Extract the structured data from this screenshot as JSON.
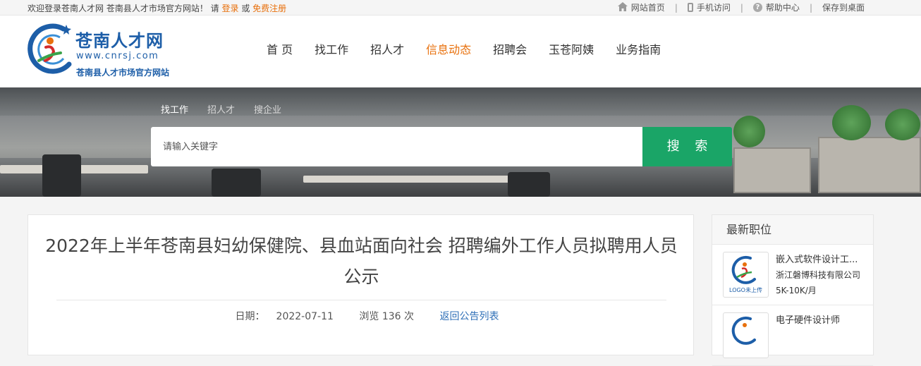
{
  "topbar": {
    "welcome_prefix": "欢迎登录苍南人才网 苍南县人才市场官方网站！ 请",
    "login": "登录",
    "or": "或",
    "register": "免费注册",
    "links": [
      {
        "icon": "home-icon",
        "label": "网站首页"
      },
      {
        "icon": "phone-icon",
        "label": "手机访问"
      },
      {
        "icon": "help-icon",
        "label": "帮助中心"
      },
      {
        "icon": "",
        "label": "保存到桌面"
      }
    ],
    "separator": "|"
  },
  "logo": {
    "name": "苍南人才网",
    "url": "www.cnrsj.com",
    "slogan": "苍南县人才市场官方网站"
  },
  "nav": {
    "items": [
      "首 页",
      "找工作",
      "招人才",
      "信息动态",
      "招聘会",
      "玉苍阿姨",
      "业务指南"
    ],
    "active_index": 3
  },
  "search": {
    "tabs": [
      "找工作",
      "招人才",
      "搜企业"
    ],
    "active_tab": 0,
    "placeholder": "请输入关键字",
    "button": "搜 索"
  },
  "article": {
    "title": "2022年上半年苍南县妇幼保健院、县血站面向社会 招聘编外工作人员拟聘用人员公示",
    "date_label": "日期：",
    "date": "2022-07-11",
    "views_label": "浏览 136 次",
    "back_link": "返回公告列表"
  },
  "sidebar": {
    "heading": "最新职位",
    "jobs": [
      {
        "title": "嵌入式软件设计工...",
        "company": "浙江磐博科技有限公司",
        "salary": "5K-10K/月",
        "logo_tag": "LOGO未上传"
      },
      {
        "title": "电子硬件设计师",
        "company": "",
        "salary": "",
        "logo_tag": ""
      }
    ]
  },
  "colors": {
    "accent": "#e8700c",
    "brand": "#1d5ea8",
    "search_button": "#1aa567",
    "link": "#2e6fb7"
  }
}
